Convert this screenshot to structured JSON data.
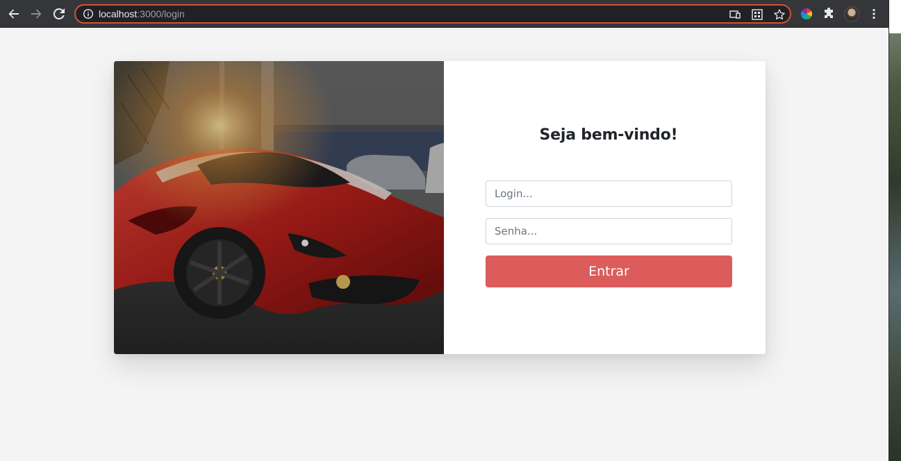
{
  "browser": {
    "url_host": "localhost",
    "url_path": ":3000/login"
  },
  "login": {
    "title": "Seja bem-vindo!",
    "login_placeholder": "Login...",
    "password_placeholder": "Senha...",
    "submit_label": "Entrar"
  },
  "colors": {
    "accent_button": "#dc5c5c",
    "page_background": "#f4f4f4",
    "omnibox_focus_border": "#d35336"
  },
  "icons": {
    "back": "back-arrow-icon",
    "forward": "forward-arrow-icon",
    "reload": "reload-icon",
    "site_info": "info-icon",
    "cast": "cast-icon",
    "qr": "qr-code-icon",
    "bookmark": "star-icon",
    "color_picker_extension": "color-wheel-icon",
    "extensions": "puzzle-icon",
    "profile": "avatar",
    "menu": "kebab-menu-icon"
  }
}
